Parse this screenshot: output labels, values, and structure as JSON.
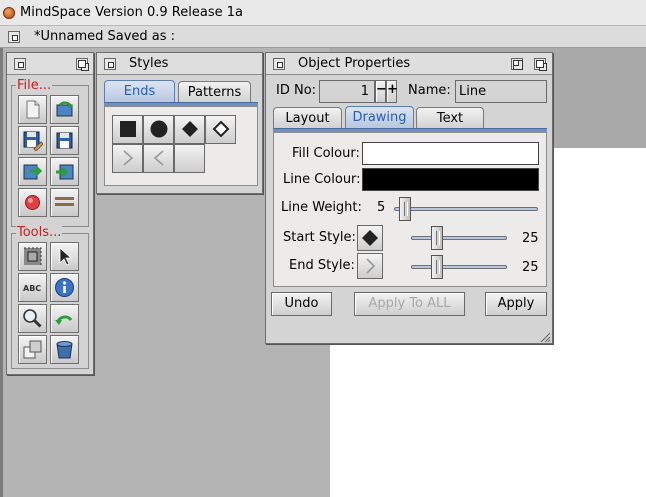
{
  "app": {
    "title": "MindSpace Version 0.9 Release 1a",
    "document_status": "*Unnamed Saved as :"
  },
  "tools_window": {
    "file_group_label": "File...",
    "tools_group_label": "Tools...",
    "file_icons": [
      "new-file-icon",
      "open-file-icon",
      "save-edit-icon",
      "save-as-icon",
      "import-icon",
      "export-icon",
      "record-icon",
      "line-tool-icon"
    ],
    "tool_icons": [
      "grid-select-icon",
      "arrow-pointer-icon",
      "text-abc-icon",
      "info-icon",
      "magnify-icon",
      "undo-curve-icon",
      "layers-icon",
      "trash-bucket-icon"
    ]
  },
  "styles_window": {
    "title": "Styles",
    "tabs": [
      {
        "label": "Ends",
        "active": true
      },
      {
        "label": "Patterns",
        "active": false
      }
    ],
    "end_styles": [
      "square-end-icon",
      "circle-end-icon",
      "diamond-end-icon",
      "hollow-diamond-end-icon",
      "right-arrow-end-icon",
      "left-arrow-end-icon",
      "empty-end-icon"
    ]
  },
  "properties_window": {
    "title": "Object Properties",
    "id_label": "ID No:",
    "id_value": "1",
    "name_label": "Name:",
    "name_value": "Line",
    "tabs": [
      {
        "label": "Layout",
        "active": false
      },
      {
        "label": "Drawing",
        "active": true
      },
      {
        "label": "Text",
        "active": false
      }
    ],
    "fill_colour_label": "Fill Colour:",
    "fill_colour": "#ffffff",
    "line_colour_label": "Line Colour:",
    "line_colour": "#000000",
    "line_weight_label": "Line Weight:",
    "line_weight_value": "5",
    "start_style_label": "Start Style:",
    "start_style_value": "25",
    "end_style_label": "End Style:",
    "end_style_value": "25",
    "undo_label": "Undo",
    "apply_all_label": "Apply To ALL",
    "apply_label": "Apply"
  },
  "colors": {
    "accent_tab": "#2a5db0",
    "group_label": "#c62020"
  }
}
